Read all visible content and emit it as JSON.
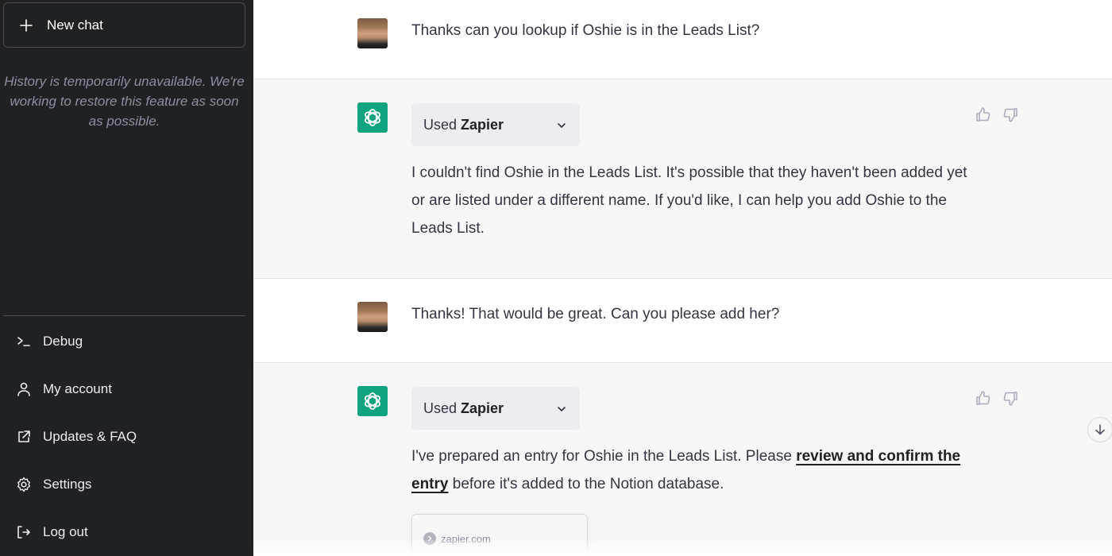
{
  "sidebar": {
    "new_chat_label": "New chat",
    "history_note": "History is temporarily unavailable. We're working to restore this feature as soon as possible.",
    "items": [
      {
        "label": "Debug",
        "icon": "terminal-icon"
      },
      {
        "label": "My account",
        "icon": "user-icon"
      },
      {
        "label": "Updates & FAQ",
        "icon": "external-link-icon"
      },
      {
        "label": "Settings",
        "icon": "gear-icon"
      },
      {
        "label": "Log out",
        "icon": "logout-icon"
      }
    ]
  },
  "conversation": {
    "messages": [
      {
        "role": "user",
        "text": "Thanks can you lookup if Oshie is in the Leads List?"
      },
      {
        "role": "assistant",
        "plugin_used_prefix": "Used ",
        "plugin_name": "Zapier",
        "text": "I couldn't find Oshie in the Leads List. It's possible that they haven't been added yet or are listed under a different name. If you'd like, I can help you add Oshie to the Leads List."
      },
      {
        "role": "user",
        "text": "Thanks! That would be great. Can you please add her?"
      },
      {
        "role": "assistant",
        "plugin_used_prefix": "Used ",
        "plugin_name": "Zapier",
        "text_before": "I've prepared an entry for Oshie in the Leads List. Please ",
        "link_text": "review and confirm the entry",
        "text_after": " before it's added to the Notion database.",
        "card_source": "zapier.com"
      }
    ]
  },
  "colors": {
    "sidebar_bg": "#202123",
    "assistant_bg": "#f7f7f8",
    "brand_green": "#10a37f",
    "text": "#343541"
  }
}
